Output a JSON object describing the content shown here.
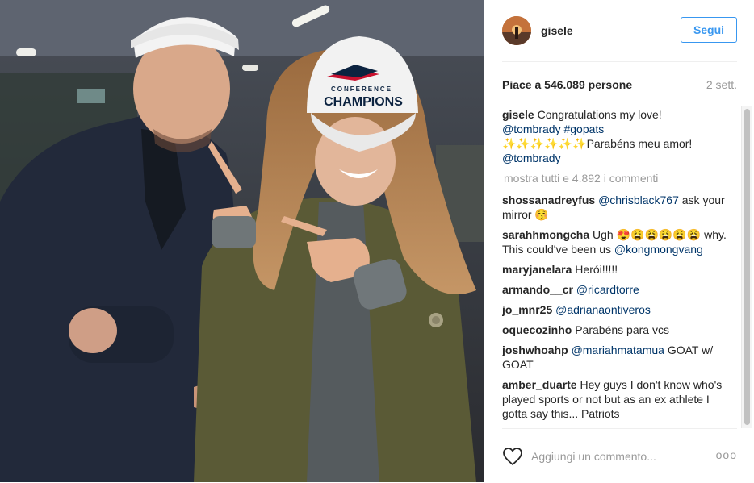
{
  "header": {
    "username": "gisele",
    "follow_label": "Segui",
    "avatar_icon": "avatar-sunset-icon"
  },
  "photo": {
    "cap_text_top": "CONFERENCE",
    "cap_text_main": "CHAMPIONS"
  },
  "stats": {
    "likes": "Piace a 546.089 persone",
    "time": "2 sett."
  },
  "caption": {
    "user": "gisele",
    "text1": "Congratulations my love!",
    "tag1": "@tombrady",
    "tag2": "#gopats",
    "sparkles": "✨✨✨✨✨✨",
    "text2": "Parabéns meu amor!",
    "tag3": "@tombrady"
  },
  "show_all": "mostra tutti e 4.892 i commenti",
  "comments": [
    {
      "user": "shossanadreyfus",
      "mention": "@chrisblack767",
      "text": " ask your mirror 😚"
    },
    {
      "user": "sarahhmongcha",
      "mention": "",
      "text": "Ugh 😍😩😩😩😩😩 why. This could've been us",
      "mention2": "@kongmongvang"
    },
    {
      "user": "maryjanelara",
      "mention": "",
      "text": "Herói!!!!!"
    },
    {
      "user": "armando__cr",
      "mention": "@ricardtorre",
      "text": ""
    },
    {
      "user": "jo_mnr25",
      "mention": "@adrianaontiveros",
      "text": ""
    },
    {
      "user": "oquecozinho",
      "mention": "",
      "text": "Parabéns para vcs"
    },
    {
      "user": "joshwhoahp",
      "mention": "@mariahmatamua",
      "text": " GOAT w/ GOAT"
    },
    {
      "user": "amber_duarte",
      "mention": "",
      "text": "Hey guys I don't know who's played sports or not but as an ex athlete I gotta say this... Patriots"
    }
  ],
  "footer": {
    "add_comment_placeholder": "Aggiungi un commento...",
    "more_dots": "ooo",
    "heart_icon": "heart-outline-icon"
  },
  "colors": {
    "link": "#003569",
    "accent": "#3897f0",
    "muted": "#999999"
  }
}
